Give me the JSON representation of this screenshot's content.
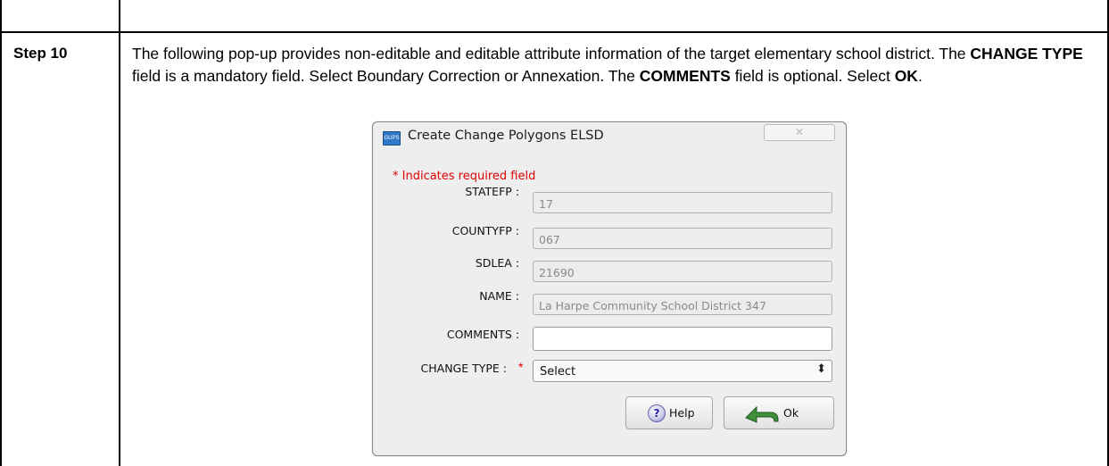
{
  "step_label": "Step 10",
  "instructions": {
    "p1": "The following pop-up provides non-editable and editable attribute information of the target elementary school district. The ",
    "b1": "CHANGE TYPE",
    "p2": " field is a mandatory field. Select Boundary Correction or Annexation. The ",
    "b2": "COMMENTS",
    "p3": " field is optional. Select ",
    "b3": "OK",
    "p4": "."
  },
  "dialog": {
    "app_icon_text": "GUPS",
    "title": "Create Change Polygons ELSD",
    "close_glyph": "✕",
    "required_note": "* Indicates required field",
    "fields": {
      "statefp": {
        "label": "STATEFP :",
        "value": "17"
      },
      "countyfp": {
        "label": "COUNTYFP :",
        "value": "067"
      },
      "sdlea": {
        "label": "SDLEA :",
        "value": "21690"
      },
      "name": {
        "label": "NAME :",
        "value": "La Harpe Community School District 347"
      },
      "comments": {
        "label": "COMMENTS :",
        "value": ""
      },
      "change_type": {
        "label": "CHANGE TYPE :",
        "required_mark": "*",
        "value": "Select",
        "arrow": "⬍"
      }
    },
    "buttons": {
      "help_icon": "?",
      "help": "Help",
      "ok": "Ok"
    }
  },
  "colors": {
    "required": "#e00000",
    "dialog_bg": "#eeeeee",
    "ok_icon": "#3f8f3a"
  }
}
